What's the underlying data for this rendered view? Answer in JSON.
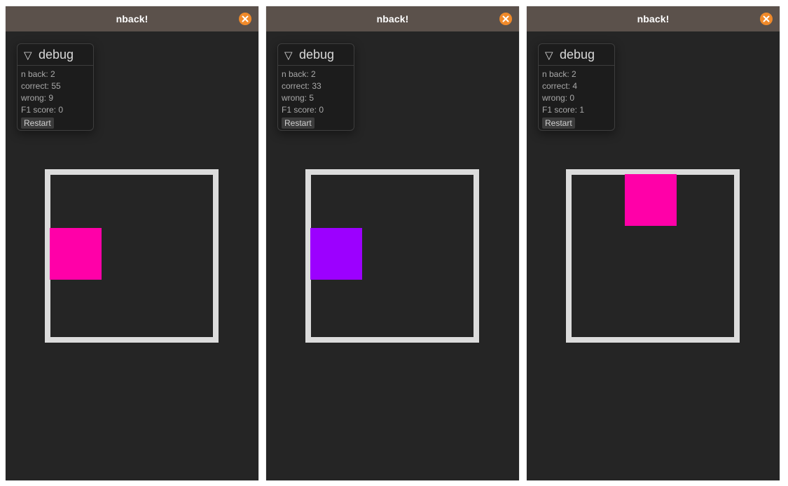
{
  "windows": [
    {
      "title": "nback!",
      "debug": {
        "header": "debug",
        "n_back": "n back: 2",
        "correct": "correct: 55",
        "wrong": "wrong: 9",
        "f1": "F1 score: 0",
        "restart_label": "Restart"
      },
      "stimulus": {
        "row": 1,
        "col": 0,
        "color": "#ff00a8"
      }
    },
    {
      "title": "nback!",
      "debug": {
        "header": "debug",
        "n_back": "n back: 2",
        "correct": "correct: 33",
        "wrong": "wrong: 5",
        "f1": "F1 score: 0",
        "restart_label": "Restart"
      },
      "stimulus": {
        "row": 1,
        "col": 0,
        "color": "#9c00ff"
      }
    },
    {
      "title": "nback!",
      "debug": {
        "header": "debug",
        "n_back": "n back: 2",
        "correct": "correct: 4",
        "wrong": "wrong: 0",
        "f1": "F1 score: 1",
        "restart_label": "Restart"
      },
      "stimulus": {
        "row": 0,
        "col": 1,
        "color": "#ff00a8"
      }
    }
  ],
  "icons": {
    "close": "close-icon",
    "collapse": "triangle-down-icon"
  },
  "colors": {
    "titlebar": "#5b514b",
    "window_bg": "#252525",
    "close_button": "#f08a2a",
    "grid_border": "#dcdcdc"
  }
}
